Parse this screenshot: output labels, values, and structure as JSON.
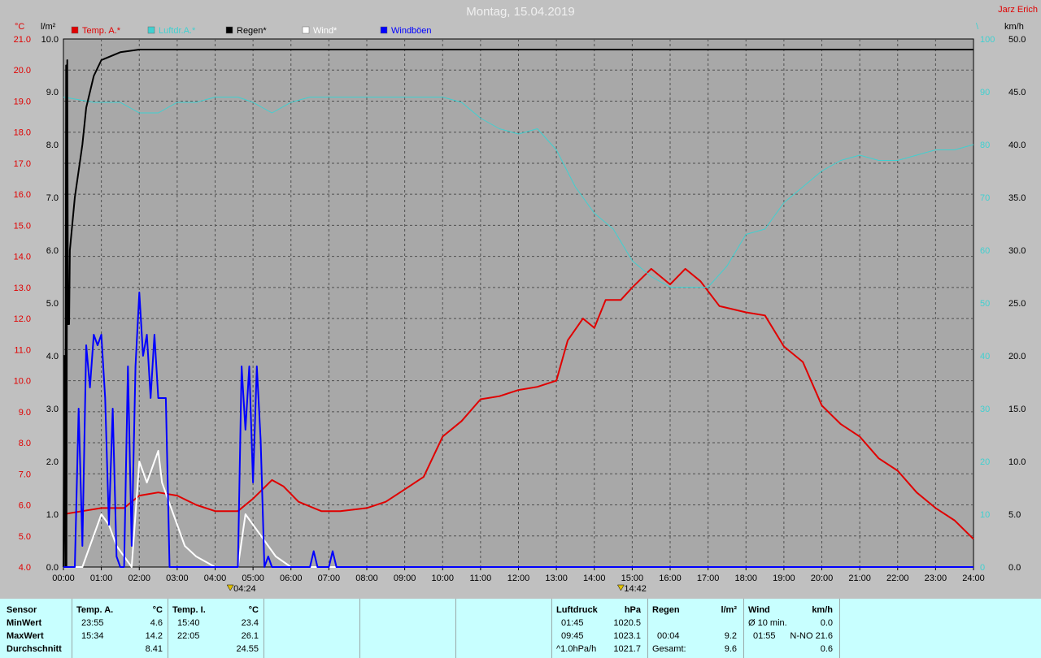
{
  "header": {
    "title": "Montag, 15.04.2019",
    "station": "Jarz Erich"
  },
  "colors": {
    "background": "#c0c0c0",
    "plot": "#a8a8a8",
    "temp": "#e00000",
    "pressure": "#40d0d0",
    "rain": "#000000",
    "wind": "#ffffff",
    "gusts": "#0000ff",
    "info_panel": "#c8ffff"
  },
  "chart_data": {
    "type": "line",
    "axes": {
      "temp": {
        "unit": "°C",
        "range": [
          4.0,
          21.0
        ],
        "ticks": [
          "4.0",
          "5.0",
          "6.0",
          "7.0",
          "8.0",
          "9.0",
          "10.0",
          "11.0",
          "12.0",
          "13.0",
          "14.0",
          "15.0",
          "16.0",
          "17.0",
          "18.0",
          "19.0",
          "20.0",
          "21.0"
        ]
      },
      "rain": {
        "unit": "l/m²",
        "range": [
          0.0,
          10.0
        ],
        "ticks": [
          "0.0",
          "1.0",
          "2.0",
          "3.0",
          "4.0",
          "5.0",
          "6.0",
          "7.0",
          "8.0",
          "9.0",
          "10.0"
        ]
      },
      "pressure": {
        "unit": "\\",
        "range": [
          0,
          100
        ],
        "ticks": [
          "0",
          "10",
          "20",
          "30",
          "40",
          "50",
          "60",
          "70",
          "80",
          "90",
          "100"
        ]
      },
      "wind": {
        "unit": "km/h",
        "range": [
          0.0,
          50.0
        ],
        "ticks": [
          "0.0",
          "5.0",
          "10.0",
          "15.0",
          "20.0",
          "25.0",
          "30.0",
          "35.0",
          "40.0",
          "45.0",
          "50.0"
        ]
      },
      "x": {
        "range": [
          0,
          24
        ],
        "ticks": [
          "00:00",
          "01:00",
          "02:00",
          "03:00",
          "04:00",
          "05:00",
          "06:00",
          "07:00",
          "08:00",
          "09:00",
          "10:00",
          "11:00",
          "12:00",
          "13:00",
          "14:00",
          "15:00",
          "16:00",
          "17:00",
          "18:00",
          "19:00",
          "20:00",
          "21:00",
          "22:00",
          "23:00",
          "24:00"
        ]
      }
    },
    "markers": [
      {
        "label": "04:24",
        "x": 4.4
      },
      {
        "label": "14:42",
        "x": 14.7
      }
    ],
    "legend": [
      {
        "label": "Temp. A.*",
        "color": "#e00000"
      },
      {
        "label": "Luftdr.A.*",
        "color": "#40d0d0"
      },
      {
        "label": "Regen*",
        "color": "#000000"
      },
      {
        "label": "Wind*",
        "color": "#ffffff"
      },
      {
        "label": "Windböen",
        "color": "#0000ff"
      }
    ],
    "series": [
      {
        "name": "Temp. A.*",
        "axis": "temp",
        "color": "#e00000",
        "width": 2,
        "points": [
          [
            0,
            5.7
          ],
          [
            0.5,
            5.8
          ],
          [
            1,
            5.9
          ],
          [
            1.6,
            5.9
          ],
          [
            2,
            6.3
          ],
          [
            2.5,
            6.4
          ],
          [
            3,
            6.3
          ],
          [
            3.5,
            6.0
          ],
          [
            4,
            5.8
          ],
          [
            4.6,
            5.8
          ],
          [
            5,
            6.2
          ],
          [
            5.5,
            6.8
          ],
          [
            5.8,
            6.6
          ],
          [
            6.2,
            6.1
          ],
          [
            6.8,
            5.8
          ],
          [
            7.3,
            5.8
          ],
          [
            8,
            5.9
          ],
          [
            8.5,
            6.1
          ],
          [
            9,
            6.5
          ],
          [
            9.5,
            6.9
          ],
          [
            10,
            8.2
          ],
          [
            10.5,
            8.7
          ],
          [
            11,
            9.4
          ],
          [
            11.5,
            9.5
          ],
          [
            12,
            9.7
          ],
          [
            12.5,
            9.8
          ],
          [
            13,
            10.0
          ],
          [
            13.3,
            11.3
          ],
          [
            13.7,
            12.0
          ],
          [
            14,
            11.7
          ],
          [
            14.3,
            12.6
          ],
          [
            14.7,
            12.6
          ],
          [
            15,
            13.0
          ],
          [
            15.5,
            13.6
          ],
          [
            16,
            13.1
          ],
          [
            16.4,
            13.6
          ],
          [
            16.8,
            13.2
          ],
          [
            17.3,
            12.4
          ],
          [
            18,
            12.2
          ],
          [
            18.5,
            12.1
          ],
          [
            19,
            11.1
          ],
          [
            19.5,
            10.6
          ],
          [
            20,
            9.2
          ],
          [
            20.5,
            8.6
          ],
          [
            21,
            8.2
          ],
          [
            21.5,
            7.5
          ],
          [
            22,
            7.1
          ],
          [
            22.5,
            6.4
          ],
          [
            23,
            5.9
          ],
          [
            23.5,
            5.5
          ],
          [
            24,
            4.9
          ]
        ]
      },
      {
        "name": "Luftdr.A.*",
        "axis": "pressure",
        "color": "#40d0d0",
        "width": 1,
        "points": [
          [
            0,
            89
          ],
          [
            0.8,
            88
          ],
          [
            1,
            88
          ],
          [
            1.5,
            88
          ],
          [
            2,
            86
          ],
          [
            2.5,
            86
          ],
          [
            3,
            88
          ],
          [
            3.5,
            88
          ],
          [
            4,
            89
          ],
          [
            4.6,
            89
          ],
          [
            5,
            88
          ],
          [
            5.5,
            86
          ],
          [
            6,
            88
          ],
          [
            6.5,
            89
          ],
          [
            7,
            89
          ],
          [
            8,
            89
          ],
          [
            9,
            89
          ],
          [
            10,
            89
          ],
          [
            10.5,
            88
          ],
          [
            11,
            85
          ],
          [
            11.5,
            83
          ],
          [
            12,
            82
          ],
          [
            12.5,
            83
          ],
          [
            13,
            79
          ],
          [
            13.5,
            72
          ],
          [
            14,
            67
          ],
          [
            14.5,
            64
          ],
          [
            15,
            58
          ],
          [
            15.5,
            55
          ],
          [
            16,
            53
          ],
          [
            16.5,
            53
          ],
          [
            17,
            53
          ],
          [
            17.5,
            57
          ],
          [
            18,
            63
          ],
          [
            18.5,
            64
          ],
          [
            19,
            69
          ],
          [
            19.5,
            72
          ],
          [
            20,
            75
          ],
          [
            20.5,
            77
          ],
          [
            21,
            78
          ],
          [
            21.5,
            77
          ],
          [
            22,
            77
          ],
          [
            22.5,
            78
          ],
          [
            23,
            79
          ],
          [
            23.5,
            79
          ],
          [
            24,
            80
          ]
        ]
      },
      {
        "name": "Regen*",
        "axis": "rain",
        "color": "#000000",
        "width": 2,
        "points": [
          [
            0,
            0
          ],
          [
            0.02,
            4
          ],
          [
            0.05,
            0
          ],
          [
            0.07,
            9.5
          ],
          [
            0.08,
            0
          ],
          [
            0.1,
            9.6
          ],
          [
            0.12,
            4.6
          ],
          [
            0.15,
            4.6
          ],
          [
            0.17,
            6.0
          ],
          [
            0.3,
            7.0
          ],
          [
            0.5,
            8.0
          ],
          [
            0.6,
            8.7
          ],
          [
            0.8,
            9.3
          ],
          [
            1,
            9.6
          ],
          [
            1.5,
            9.75
          ],
          [
            2,
            9.8
          ],
          [
            24,
            9.8
          ]
        ]
      },
      {
        "name": "Wind*",
        "axis": "wind",
        "color": "#ffffff",
        "width": 2,
        "points": [
          [
            0,
            0
          ],
          [
            0.5,
            0
          ],
          [
            0.7,
            2
          ],
          [
            0.9,
            4
          ],
          [
            1,
            5
          ],
          [
            1.2,
            4
          ],
          [
            1.4,
            2
          ],
          [
            1.6,
            1
          ],
          [
            1.8,
            0
          ],
          [
            2,
            10
          ],
          [
            2.2,
            8
          ],
          [
            2.4,
            10
          ],
          [
            2.5,
            11
          ],
          [
            2.6,
            8
          ],
          [
            2.8,
            6
          ],
          [
            3,
            4
          ],
          [
            3.2,
            2
          ],
          [
            3.5,
            1
          ],
          [
            4,
            0
          ],
          [
            4.6,
            0
          ],
          [
            4.8,
            5
          ],
          [
            5,
            4
          ],
          [
            5.2,
            3
          ],
          [
            5.4,
            2
          ],
          [
            5.6,
            1
          ],
          [
            6,
            0
          ],
          [
            24,
            0
          ]
        ]
      },
      {
        "name": "Windböen",
        "axis": "wind",
        "color": "#0000ff",
        "width": 2,
        "points": [
          [
            0,
            0
          ],
          [
            0.3,
            0
          ],
          [
            0.4,
            15
          ],
          [
            0.5,
            2
          ],
          [
            0.6,
            21
          ],
          [
            0.7,
            17
          ],
          [
            0.8,
            22
          ],
          [
            0.9,
            21
          ],
          [
            1,
            22
          ],
          [
            1.1,
            16
          ],
          [
            1.2,
            4
          ],
          [
            1.3,
            15
          ],
          [
            1.4,
            1
          ],
          [
            1.5,
            0
          ],
          [
            1.6,
            0
          ],
          [
            1.7,
            19
          ],
          [
            1.8,
            2
          ],
          [
            1.9,
            19
          ],
          [
            2,
            26
          ],
          [
            2.1,
            20
          ],
          [
            2.2,
            22
          ],
          [
            2.3,
            16
          ],
          [
            2.4,
            22
          ],
          [
            2.5,
            16
          ],
          [
            2.7,
            16
          ],
          [
            2.8,
            0
          ],
          [
            4.6,
            0
          ],
          [
            4.7,
            19
          ],
          [
            4.8,
            13
          ],
          [
            4.9,
            19
          ],
          [
            5,
            8
          ],
          [
            5.1,
            19
          ],
          [
            5.2,
            12
          ],
          [
            5.3,
            0
          ],
          [
            5.4,
            1
          ],
          [
            5.5,
            0
          ],
          [
            6.5,
            0
          ],
          [
            6.6,
            1.5
          ],
          [
            6.7,
            0
          ],
          [
            7,
            0
          ],
          [
            7.1,
            1.5
          ],
          [
            7.2,
            0
          ],
          [
            24,
            0
          ]
        ]
      }
    ]
  },
  "info": {
    "sensor": {
      "title": "Sensor",
      "rows": [
        "MinWert",
        "MaxWert",
        "Durchschnitt"
      ]
    },
    "temp_a": {
      "title": "Temp. A.",
      "unit": "°C",
      "min_time": "23:55",
      "min_val": "4.6",
      "max_time": "15:34",
      "max_val": "14.2",
      "avg": "8.41"
    },
    "temp_i": {
      "title": "Temp. I.",
      "unit": "°C",
      "min_time": "15:40",
      "min_val": "23.4",
      "max_time": "22:05",
      "max_val": "26.1",
      "avg": "24.55"
    },
    "pressure": {
      "title": "Luftdruck",
      "unit": "hPa",
      "min_time": "01:45",
      "min_val": "1020.5",
      "max_time": "09:45",
      "max_val": "1023.1",
      "trend_label": "^1.0hPa/h",
      "trend_val": "1021.7"
    },
    "rain": {
      "title": "Regen",
      "unit": "l/m²",
      "max_time": "00:04",
      "max_val": "9.2",
      "total_label": "Gesamt:",
      "total_val": "9.6"
    },
    "wind": {
      "title": "Wind",
      "unit": "km/h",
      "avg_label": "Ø 10 min.",
      "avg_val": "0.0",
      "max_time": "01:55",
      "max_val": "N-NO 21.6",
      "mean_val": "0.6"
    }
  }
}
